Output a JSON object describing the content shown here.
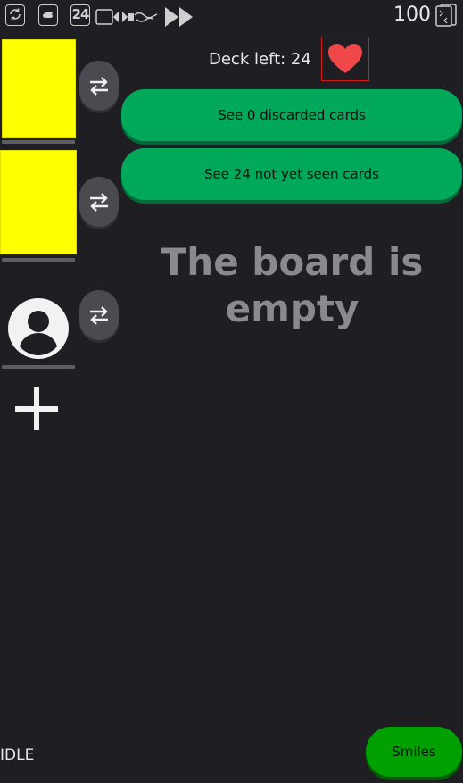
{
  "top_bar": {
    "icons": [
      "refresh-icon",
      "hand-icon",
      "card-count-icon",
      "transfer-icon",
      "fast-forward-icon",
      "deck-icon"
    ],
    "card_count": "24",
    "score": "100"
  },
  "players": {
    "swap_icon": "swap-arrows-icon",
    "avatar_icon": "person-icon",
    "add_icon": "plus-icon",
    "card_color": "#ffff00"
  },
  "deck": {
    "label": "Deck left: 24",
    "suit_icon": "heart-icon",
    "suit_color": "#f04848"
  },
  "buttons": {
    "discarded": "See 0 discarded cards",
    "unseen": "See 24 not yet seen cards",
    "smiles": "Smiles"
  },
  "board": {
    "empty_message": "The board is empty"
  },
  "status": {
    "text": "IDLE"
  },
  "colors": {
    "background": "#1f1f23",
    "primary_green": "#00a85a",
    "smiles_green": "#00a000"
  }
}
